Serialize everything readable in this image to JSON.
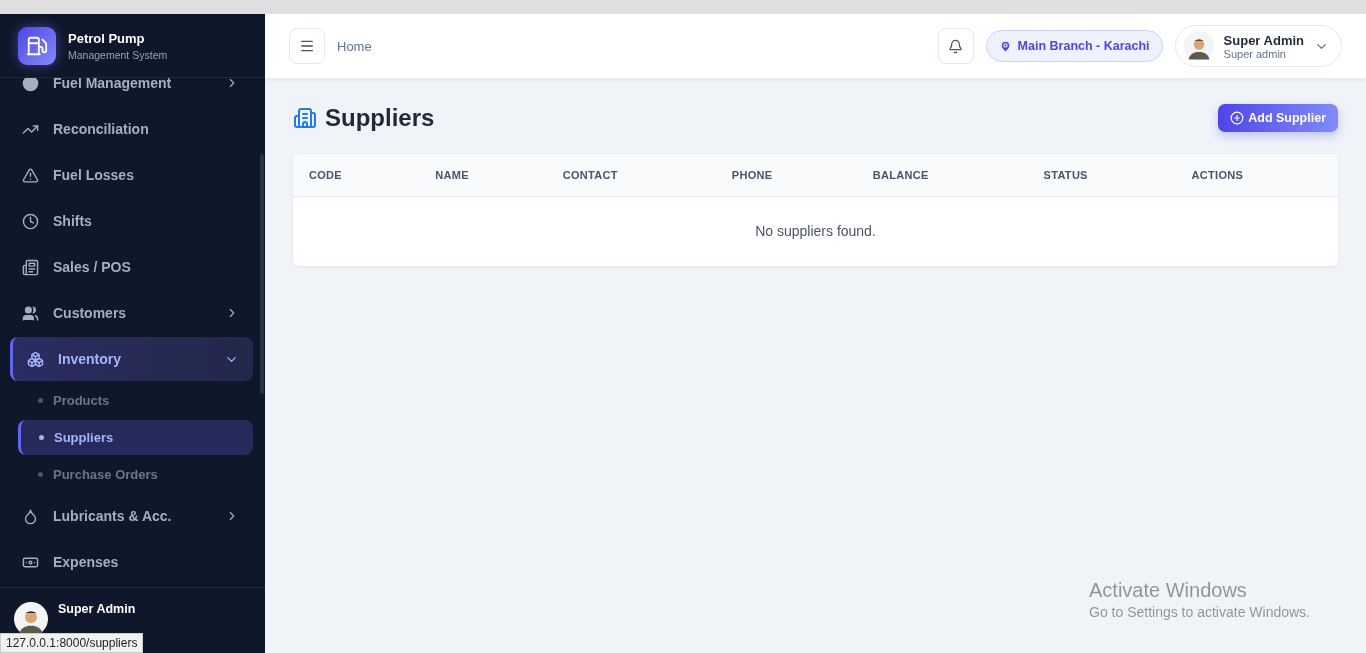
{
  "brand": {
    "title": "Petrol Pump",
    "subtitle": "Management System"
  },
  "sidebar": {
    "items": [
      {
        "label": "Fuel Management",
        "kind": "group",
        "expanded": false,
        "selected": false
      },
      {
        "label": "Reconciliation",
        "kind": "link",
        "selected": false
      },
      {
        "label": "Fuel Losses",
        "kind": "link",
        "selected": false
      },
      {
        "label": "Shifts",
        "kind": "link",
        "selected": false
      },
      {
        "label": "Sales / POS",
        "kind": "link",
        "selected": false
      },
      {
        "label": "Customers",
        "kind": "group",
        "expanded": false,
        "selected": false
      },
      {
        "label": "Inventory",
        "kind": "group",
        "expanded": true,
        "selected": true,
        "children": [
          {
            "label": "Products",
            "selected": false
          },
          {
            "label": "Suppliers",
            "selected": true
          },
          {
            "label": "Purchase Orders",
            "selected": false
          }
        ]
      },
      {
        "label": "Lubricants & Acc.",
        "kind": "group",
        "expanded": false,
        "selected": false
      },
      {
        "label": "Expenses",
        "kind": "link",
        "selected": false
      }
    ],
    "user": {
      "name": "Super Admin"
    }
  },
  "link_preview": "127.0.0.1:8000/suppliers",
  "header": {
    "breadcrumb": "Home",
    "branch": "Main Branch - Karachi",
    "user": {
      "name": "Super Admin",
      "role": "Super admin"
    }
  },
  "page": {
    "title": "Suppliers",
    "add_button": "Add Supplier",
    "table": {
      "columns": [
        "CODE",
        "NAME",
        "CONTACT",
        "PHONE",
        "BALANCE",
        "STATUS",
        "ACTIONS"
      ],
      "empty_message": "No suppliers found."
    }
  },
  "os_notice": {
    "title": "Activate Windows",
    "text": "Go to Settings to activate Windows."
  }
}
